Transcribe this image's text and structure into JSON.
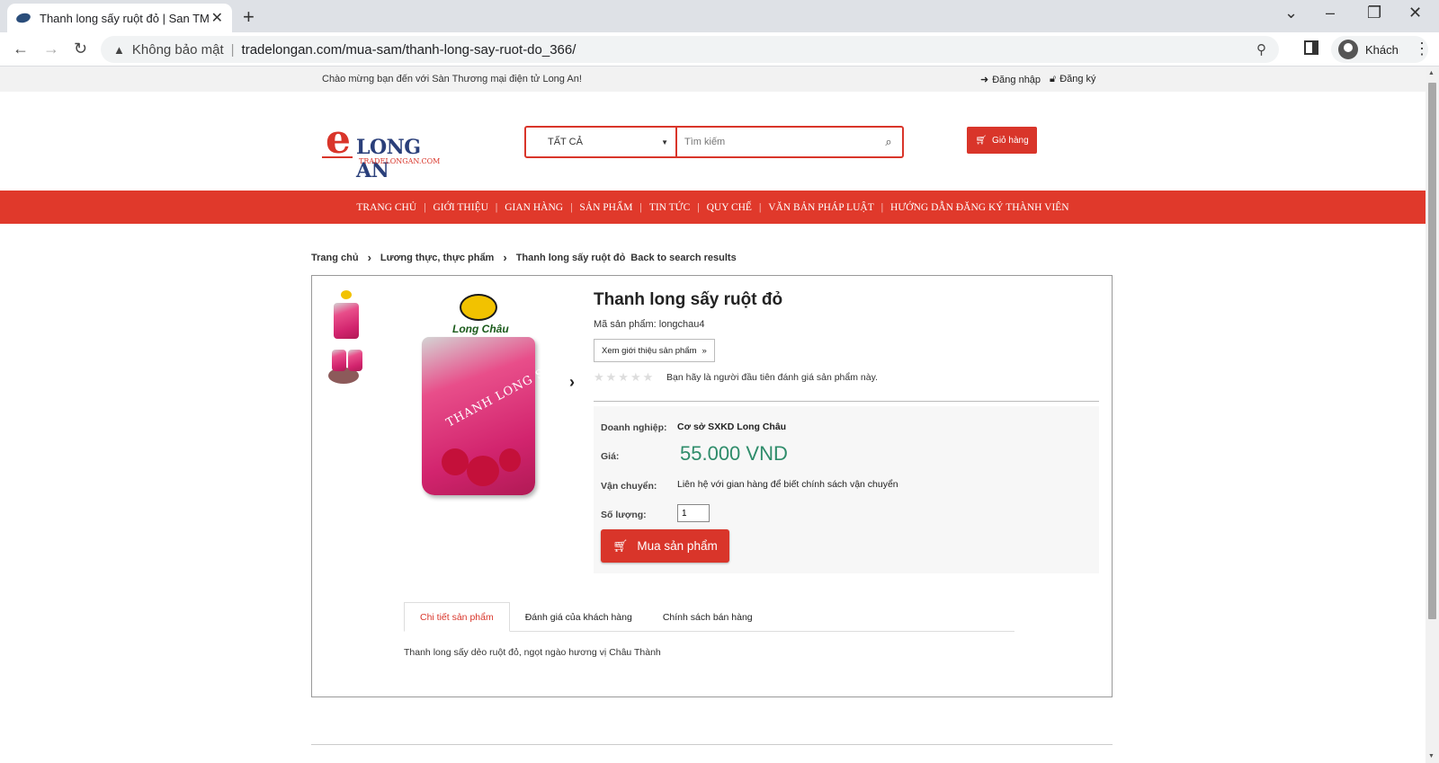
{
  "browser": {
    "tab_title": "Thanh long sấy ruột đỏ | San TM",
    "security_label": "Không bảo mật",
    "url": "tradelongan.com/mua-sam/thanh-long-say-ruot-do_366/",
    "profile_label": "Khách"
  },
  "topbar": {
    "welcome": "Chào mừng bạn đến với Sàn Thương mại điện tử Long An!",
    "login": "Đăng nhập",
    "register": "Đăng ký"
  },
  "header": {
    "logo_text": "LONG AN",
    "logo_sub": "TRADELONGAN.COM",
    "category_select": "TẤT CẢ",
    "search_placeholder": "Tìm kiếm",
    "cart_label": "Giỏ hàng"
  },
  "nav": {
    "items": [
      "TRANG CHỦ",
      "GIỚI THIỆU",
      "GIAN HÀNG",
      "SẢN PHẨM",
      "TIN TỨC",
      "QUY CHẾ",
      "VĂN BẢN PHÁP LUẬT",
      "HƯỚNG DẪN ĐĂNG KÝ THÀNH VIÊN"
    ]
  },
  "breadcrumb": {
    "home": "Trang chủ",
    "category": "Lương thực, thực phẩm",
    "current": "Thanh long sấy ruột đỏ",
    "back": "Back to search results"
  },
  "product": {
    "image_brand": "Long Châu",
    "image_text": "THANH LONG SẤY",
    "title": "Thanh long sấy ruột đỏ",
    "sku_line": "Mã sản phẩm: longchau4",
    "intro_button": "Xem giới thiệu sản phẩm",
    "rating_note": "Bạn hãy là người đầu tiên đánh giá sản phẩm này.",
    "rating_stars": 0,
    "business_label": "Doanh nghiệp:",
    "business_value": "Cơ sở SXKD Long Châu",
    "price_label": "Giá:",
    "price_value": "55.000 VND",
    "shipping_label": "Vận chuyển:",
    "shipping_value": "Liên hệ với gian hàng để biết chính sách vận chuyển",
    "qty_label": "Số lượng:",
    "qty_value": "1",
    "buy_button": "Mua sản phẩm"
  },
  "tabs": {
    "items": [
      "Chi tiết sản phẩm",
      "Đánh giá của khách hàng",
      "Chính sách bán hàng"
    ],
    "active": 0,
    "description": "Thanh long sấy dẻo ruột đỏ, ngọt ngào hương vị Châu Thành"
  },
  "colors": {
    "brand_red": "#e0392b",
    "price_green": "#2e8c6a",
    "logo_blue": "#2a3f7a"
  }
}
